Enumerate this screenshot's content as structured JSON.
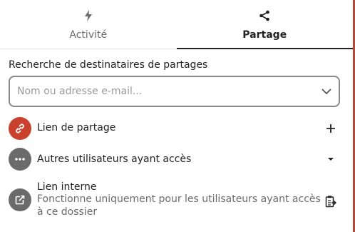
{
  "tabs": [
    {
      "label": "Activité",
      "icon": "flash-icon",
      "active": false
    },
    {
      "label": "Partage",
      "icon": "share-icon",
      "active": true
    }
  ],
  "search": {
    "label": "Recherche de destinataires de partages",
    "placeholder": "Nom ou adresse e-mail..."
  },
  "rows": [
    {
      "title": "Lien de partage",
      "icon": "link-icon",
      "action": "add-icon",
      "avatar_color": "#c9402c"
    },
    {
      "title": "Autres utilisateurs ayant accès",
      "icon": "more-icon",
      "action": "triangle-down-icon",
      "avatar_color": "#6b6b6b"
    },
    {
      "title": "Lien interne",
      "subtitle": "Fonctionne uniquement pour les utilisateurs ayant accès à ce dossier",
      "icon": "external-link-icon",
      "action": "clipboard-icon",
      "avatar_color": "#6b6b6b"
    }
  ],
  "colors": {
    "accent": "#c9402c",
    "border": "#8a8a8a",
    "muted": "#6b6b6b"
  }
}
